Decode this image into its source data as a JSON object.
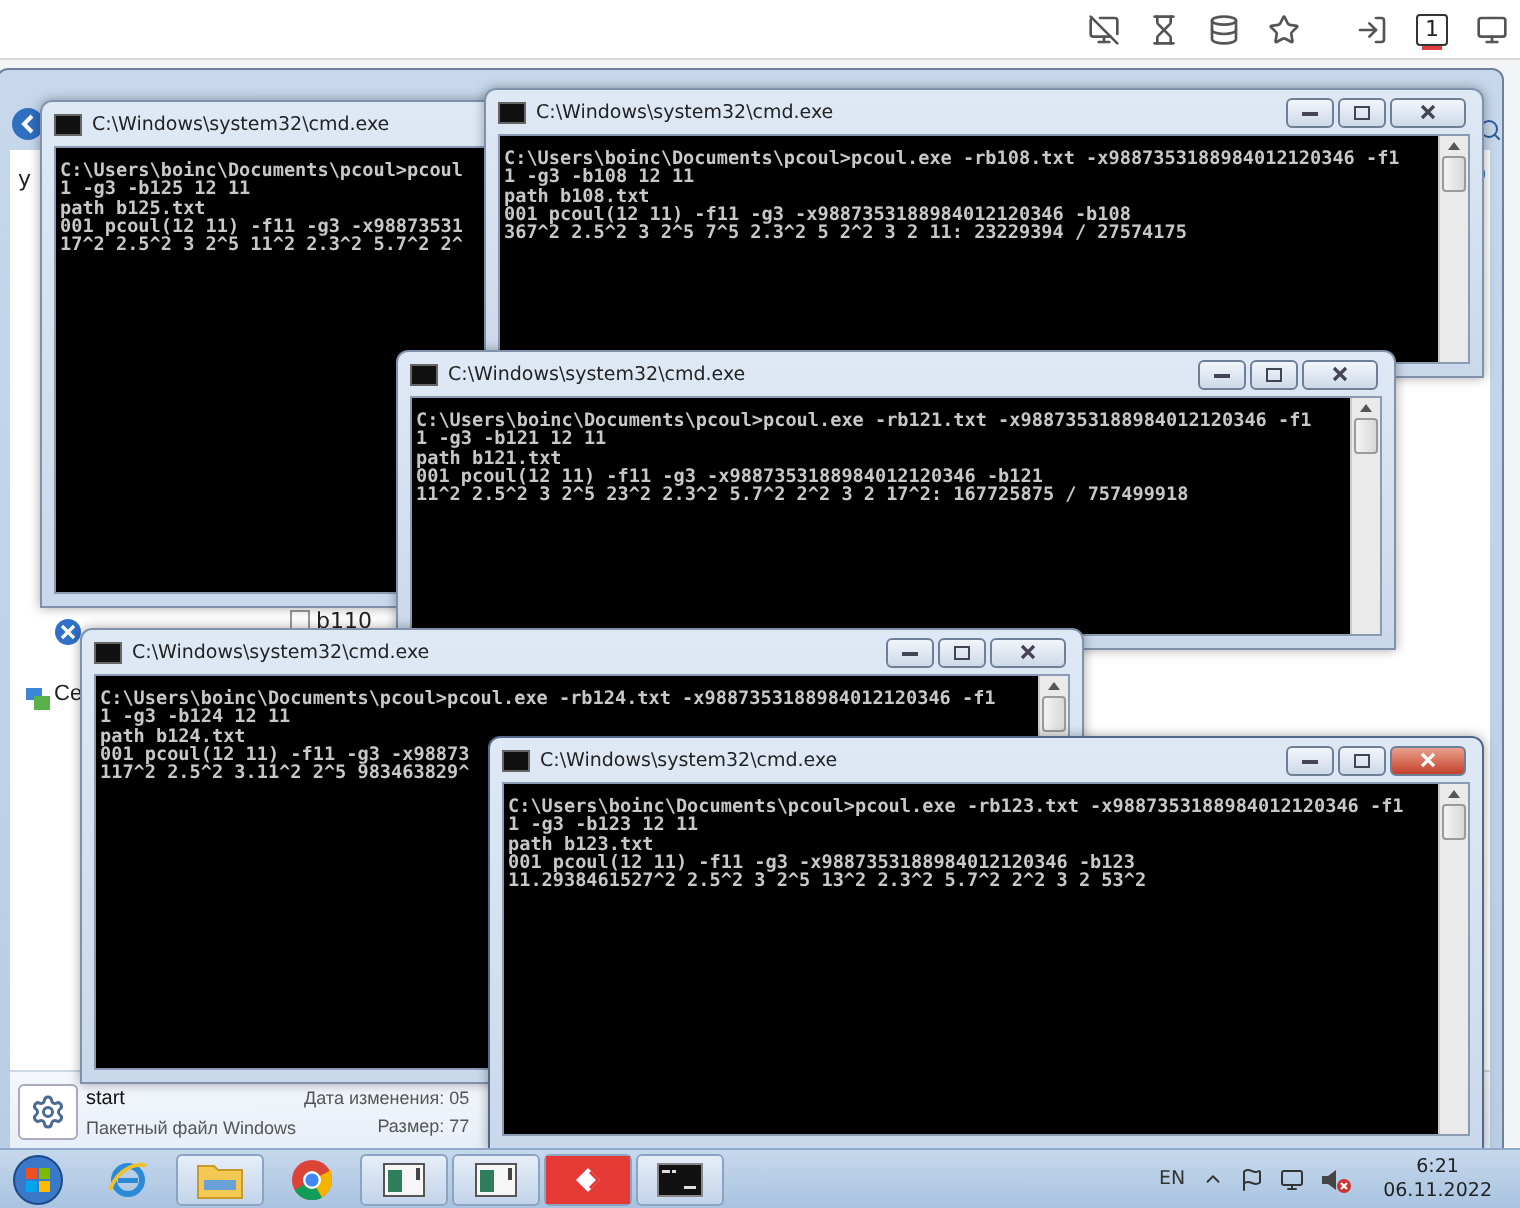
{
  "browser_toolbar": {
    "tab_count": "1"
  },
  "explorer": {
    "nav_letter": "у",
    "file_item": "b110",
    "sidebar_item": "Ce",
    "details": {
      "name": "start",
      "type": "Пакетный файл Windows",
      "modified_label": "Дата изменения: 05",
      "size_label": "Размер: 77"
    }
  },
  "windows": [
    {
      "title": "C:\\Windows\\system32\\cmd.exe",
      "active": false,
      "lines": [
        "C:\\Users\\boinc\\Documents\\pcoul>pcoul",
        "1 -g3 -b125 12 11",
        "path b125.txt",
        "001 pcoul(12 11) -f11 -g3 -x98873531",
        "17^2 2.5^2 3 2^5 11^2 2.3^2 5.7^2 2^"
      ]
    },
    {
      "title": "C:\\Windows\\system32\\cmd.exe",
      "active": false,
      "lines": [
        "C:\\Users\\boinc\\Documents\\pcoul>pcoul.exe -rb108.txt -x9887353188984012120346 -f1",
        "1 -g3 -b108 12 11",
        "path b108.txt",
        "001 pcoul(12 11) -f11 -g3 -x9887353188984012120346 -b108",
        "367^2 2.5^2 3 2^5 7^5 2.3^2 5 2^2 3 2 11: 23229394 / 27574175"
      ]
    },
    {
      "title": "C:\\Windows\\system32\\cmd.exe",
      "active": false,
      "lines": [
        "C:\\Users\\boinc\\Documents\\pcoul>pcoul.exe -rb121.txt -x9887353188984012120346 -f1",
        "1 -g3 -b121 12 11",
        "path b121.txt",
        "001 pcoul(12 11) -f11 -g3 -x9887353188984012120346 -b121",
        "11^2 2.5^2 3 2^5 23^2 2.3^2 5.7^2 2^2 3 2 17^2: 167725875 / 757499918"
      ]
    },
    {
      "title": "C:\\Windows\\system32\\cmd.exe",
      "active": false,
      "lines": [
        "C:\\Users\\boinc\\Documents\\pcoul>pcoul.exe -rb124.txt -x9887353188984012120346 -f1",
        "1 -g3 -b124 12 11",
        "path b124.txt",
        "001 pcoul(12 11) -f11 -g3 -x98873",
        "117^2 2.5^2 3.11^2 2^5 983463829^"
      ]
    },
    {
      "title": "C:\\Windows\\system32\\cmd.exe",
      "active": true,
      "lines": [
        "C:\\Users\\boinc\\Documents\\pcoul>pcoul.exe -rb123.txt -x9887353188984012120346 -f1",
        "1 -g3 -b123 12 11",
        "path b123.txt",
        "001 pcoul(12 11) -f11 -g3 -x9887353188984012120346 -b123",
        "11.2938461527^2 2.5^2 3 2^5 13^2 2.3^2 5.7^2 2^2 3 2 53^2"
      ]
    }
  ],
  "taskbar": {
    "buttons": [
      {
        "kind": "ie",
        "running": false
      },
      {
        "kind": "explorer",
        "running": true
      },
      {
        "kind": "chrome",
        "running": false
      },
      {
        "kind": "window",
        "running": true
      },
      {
        "kind": "window",
        "running": true
      },
      {
        "kind": "remote",
        "running": true
      },
      {
        "kind": "console",
        "running": true
      }
    ],
    "language": "EN",
    "time": "6:21",
    "date": "06.11.2022"
  }
}
